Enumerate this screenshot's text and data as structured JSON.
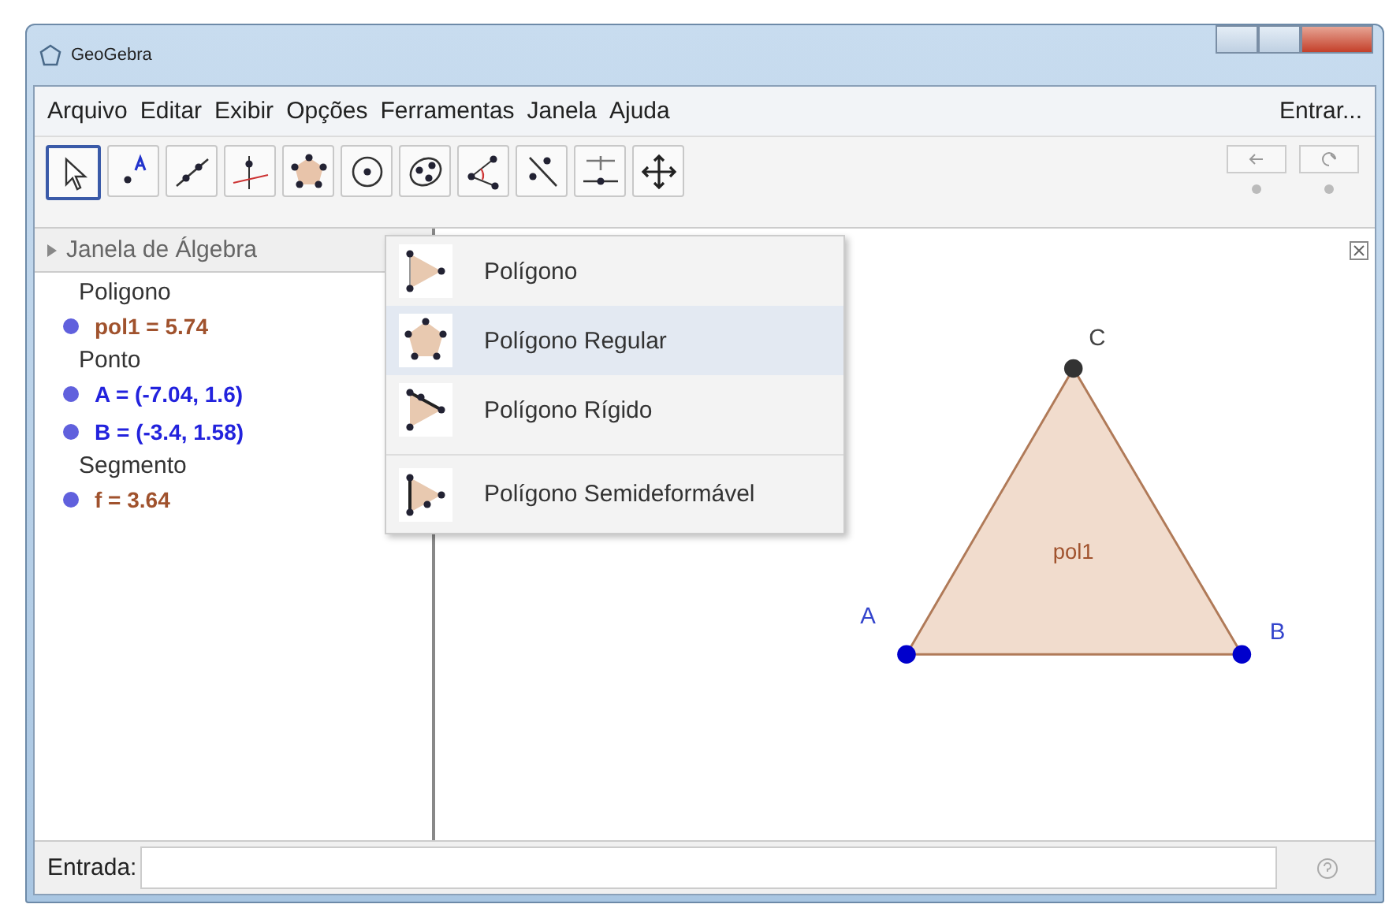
{
  "window": {
    "title": "GeoGebra"
  },
  "menu": [
    "Arquivo",
    "Editar",
    "Exibir",
    "Opções",
    "Ferramentas",
    "Janela",
    "Ajuda"
  ],
  "sign_in": "Entrar...",
  "toolbar": [
    {
      "kind": "pointer",
      "selected": true
    },
    {
      "kind": "point",
      "selected": false
    },
    {
      "kind": "line",
      "selected": false
    },
    {
      "kind": "perpendicular",
      "selected": false
    },
    {
      "kind": "polygon",
      "selected": false
    },
    {
      "kind": "circle",
      "selected": false
    },
    {
      "kind": "conic",
      "selected": false
    },
    {
      "kind": "angle",
      "selected": false
    },
    {
      "kind": "reflect",
      "selected": false
    },
    {
      "kind": "slider",
      "selected": false
    },
    {
      "kind": "move",
      "selected": false
    }
  ],
  "algebra_view": {
    "title": "Janela de Álgebra",
    "groups": [
      {
        "label": "Poligono",
        "children": [
          {
            "text": "pol1 = 5.74",
            "color": "#a0522d"
          }
        ]
      },
      {
        "label": "Ponto",
        "children": [
          {
            "text": "A = (-7.04, 1.6)",
            "color": "#2222dd"
          },
          {
            "text": "B = (-3.4, 1.58)",
            "color": "#2222dd"
          }
        ]
      },
      {
        "label": "Segmento",
        "children": [
          {
            "text": "f = 3.64",
            "color": "#a0522d"
          }
        ]
      }
    ]
  },
  "tool_menu": {
    "items": [
      {
        "label": "Polígono",
        "kind": "polygon",
        "selected": false
      },
      {
        "label": "Polígono Regular",
        "kind": "regular",
        "selected": true
      },
      {
        "label": "Polígono Rígido",
        "kind": "rigid",
        "selected": false
      },
      {
        "label": "Polígono Semideformável",
        "kind": "semi",
        "selected": false
      }
    ]
  },
  "graphics": {
    "polygon_label": "pol1",
    "points": [
      {
        "label": "A",
        "color": "#0000cc"
      },
      {
        "label": "B",
        "color": "#0000cc"
      },
      {
        "label": "C",
        "color": "#333333"
      }
    ]
  },
  "input_bar": {
    "label": "Entrada:"
  }
}
